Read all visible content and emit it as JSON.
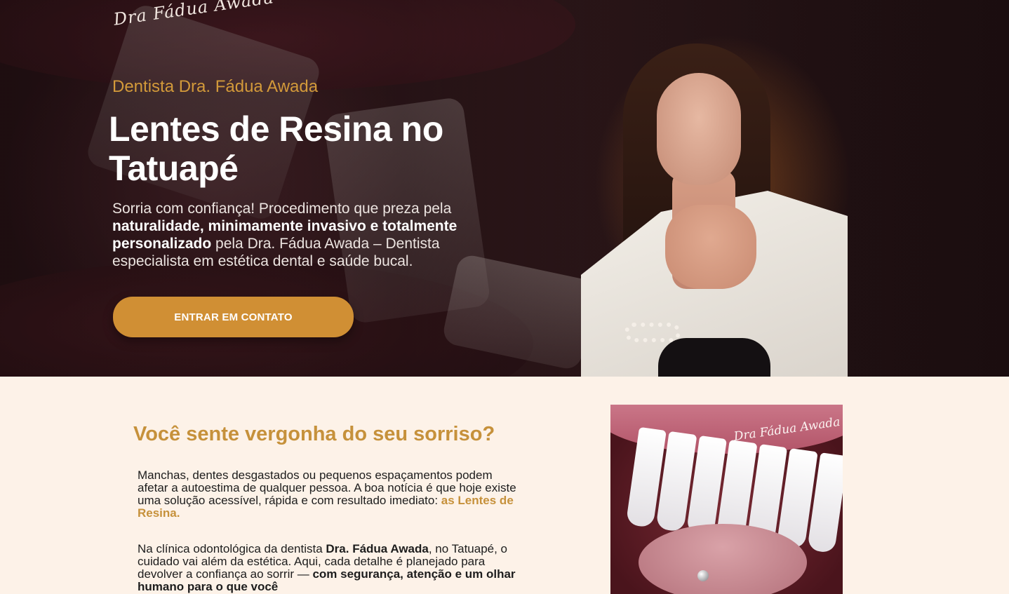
{
  "brand": {
    "logo_text": "Dra Fádua Awada"
  },
  "hero": {
    "kicker": "Dentista Dra. Fádua Awada",
    "title": "Lentes de Resina no Tatuapé",
    "text_intro": "Sorria com confiança! Procedimento que preza pela ",
    "text_bold": "naturalidade, minimamente invasivo e totalmente personalizado",
    "text_outro": " pela Dra. Fádua Awada – Dentista especialista em estética dental e saúde bucal.",
    "cta_label": "ENTRAR EM CONTATO"
  },
  "section": {
    "title": "Você sente vergonha do seu sorriso?",
    "p1_text": "Manchas, dentes desgastados ou pequenos espaçamentos podem afetar a autoestima de qualquer pessoa. A boa notícia é que hoje existe uma solução acessível, rápida e com resultado imediato: ",
    "p1_accent": "as Lentes de Resina.",
    "p2_text_a": "Na clínica odontológica da dentista ",
    "p2_bold_name": "Dra. Fádua Awada",
    "p2_text_b": ", no Tatuapé, o cuidado vai além da estética. Aqui, cada detalhe é planejado para devolver a confiança ao sorrir — ",
    "p2_bold_end": "com segurança, atenção e um olhar humano para o que você",
    "image_signature": "Dra Fádua Awada"
  },
  "colors": {
    "accent": "#c6913b",
    "button": "#d08f34",
    "section_bg": "#fdf2e8"
  }
}
